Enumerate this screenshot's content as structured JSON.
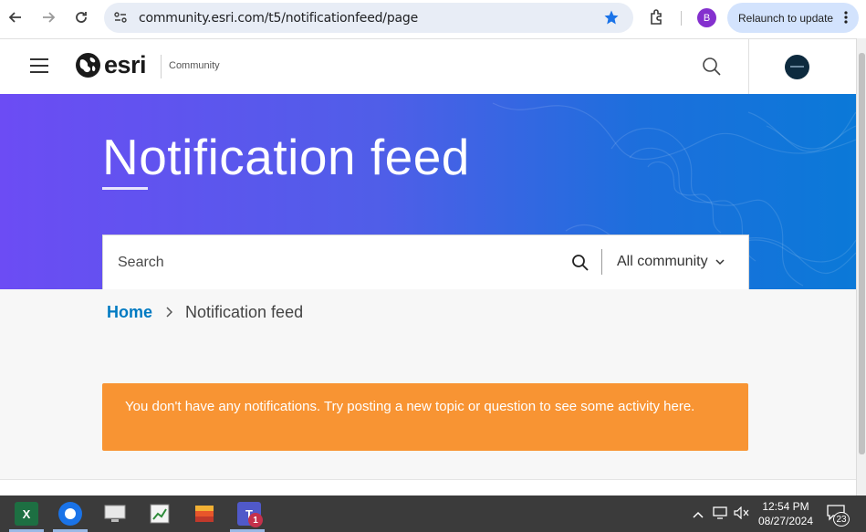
{
  "browser": {
    "url": "community.esri.com/t5/notificationfeed/page",
    "profile_initial": "B",
    "relaunch_label": "Relaunch to update"
  },
  "site": {
    "logo_text": "esri",
    "community_label": "Community"
  },
  "hero": {
    "title": "Notification feed"
  },
  "search": {
    "placeholder": "Search",
    "scope_label": "All community"
  },
  "breadcrumb": {
    "home": "Home",
    "current": "Notification feed"
  },
  "notice": {
    "message": "You don't have any notifications. Try posting a new topic or question to see some activity here."
  },
  "taskbar": {
    "time": "12:54 PM",
    "date": "08/27/2024",
    "teams_badge": "1",
    "notification_count": "23"
  },
  "colors": {
    "hero_start": "#6c4cf4",
    "hero_end": "#0b79d8",
    "breadcrumb_link": "#007ac2",
    "notice_bg": "#f89433",
    "star": "#1a73e8"
  }
}
